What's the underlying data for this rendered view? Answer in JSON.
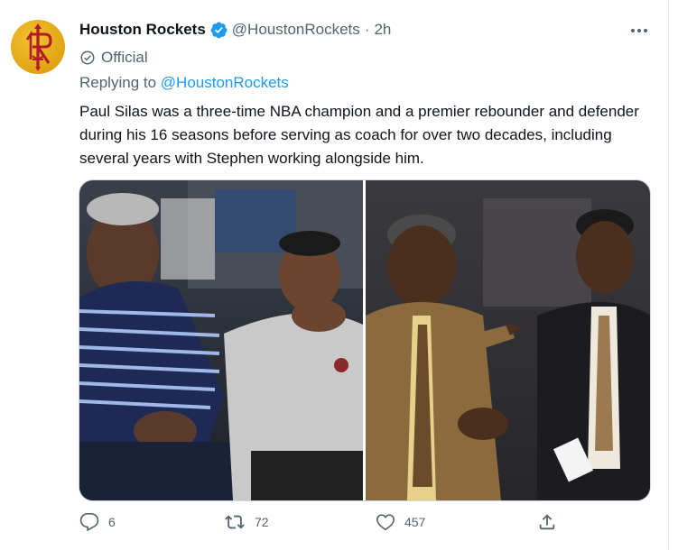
{
  "tweet": {
    "author_name": "Houston Rockets",
    "handle": "@HoustonRockets",
    "separator": "·",
    "time": "2h",
    "label": "Official",
    "replying_prefix": "Replying to",
    "replying_to": "@HoustonRockets",
    "text": "Paul Silas was a three-time NBA champion and a premier rebounder and defender during his 16 seasons before serving as coach for over two decades, including several years with Stephen working alongside him.",
    "media": [
      {
        "icon": "photo-paul-silas-courtside"
      },
      {
        "icon": "photo-paul-silas-coaching"
      }
    ]
  },
  "actions": {
    "reply_count": "6",
    "retweet_count": "72",
    "like_count": "457"
  },
  "colors": {
    "accent": "#1d9bf0",
    "text_secondary": "#536471",
    "avatar_gold": "#e0a414",
    "avatar_red": "#b11b2b"
  }
}
